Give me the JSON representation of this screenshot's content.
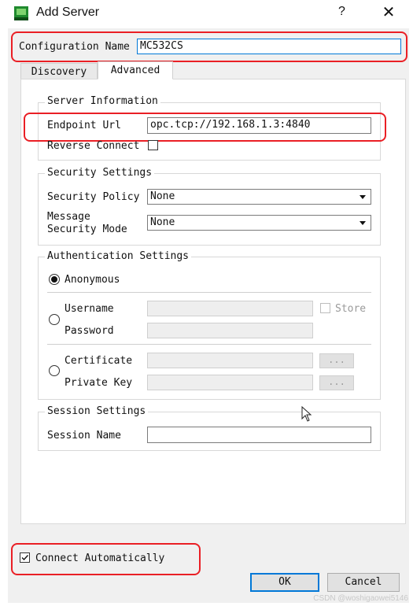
{
  "window": {
    "title": "Add Server",
    "help_glyph": "?",
    "close_glyph": "✕"
  },
  "config": {
    "label": "Configuration Name",
    "value": "MC532CS"
  },
  "tabs": [
    {
      "label": "Discovery",
      "active": false
    },
    {
      "label": "Advanced",
      "active": true
    }
  ],
  "server_info": {
    "title": "Server Information",
    "endpoint_label": "Endpoint Url",
    "endpoint_value": "opc.tcp://192.168.1.3:4840",
    "reverse_connect_label": "Reverse Connect",
    "reverse_connect_checked": false
  },
  "security": {
    "title": "Security Settings",
    "policy_label": "Security Policy",
    "policy_value": "None",
    "mode_label_line1": "Message",
    "mode_label_line2": "Security Mode",
    "mode_value": "None"
  },
  "auth": {
    "title": "Authentication Settings",
    "anonymous_label": "Anonymous",
    "username_label": "Username",
    "password_label": "Password",
    "store_label": "Store",
    "certificate_label": "Certificate",
    "private_key_label": "Private Key",
    "browse_label": "...",
    "selected": "Anonymous"
  },
  "session": {
    "title": "Session Settings",
    "name_label": "Session Name",
    "name_value": ""
  },
  "footer": {
    "connect_auto_label": "Connect Automatically",
    "connect_auto_checked": true,
    "ok_label": "OK",
    "cancel_label": "Cancel"
  },
  "watermark": "CSDN @woshigaowei5146",
  "colors": {
    "highlight_red": "#ea1f25",
    "focus_blue": "#0078d7",
    "dialog_bg": "#f0f0f0"
  }
}
